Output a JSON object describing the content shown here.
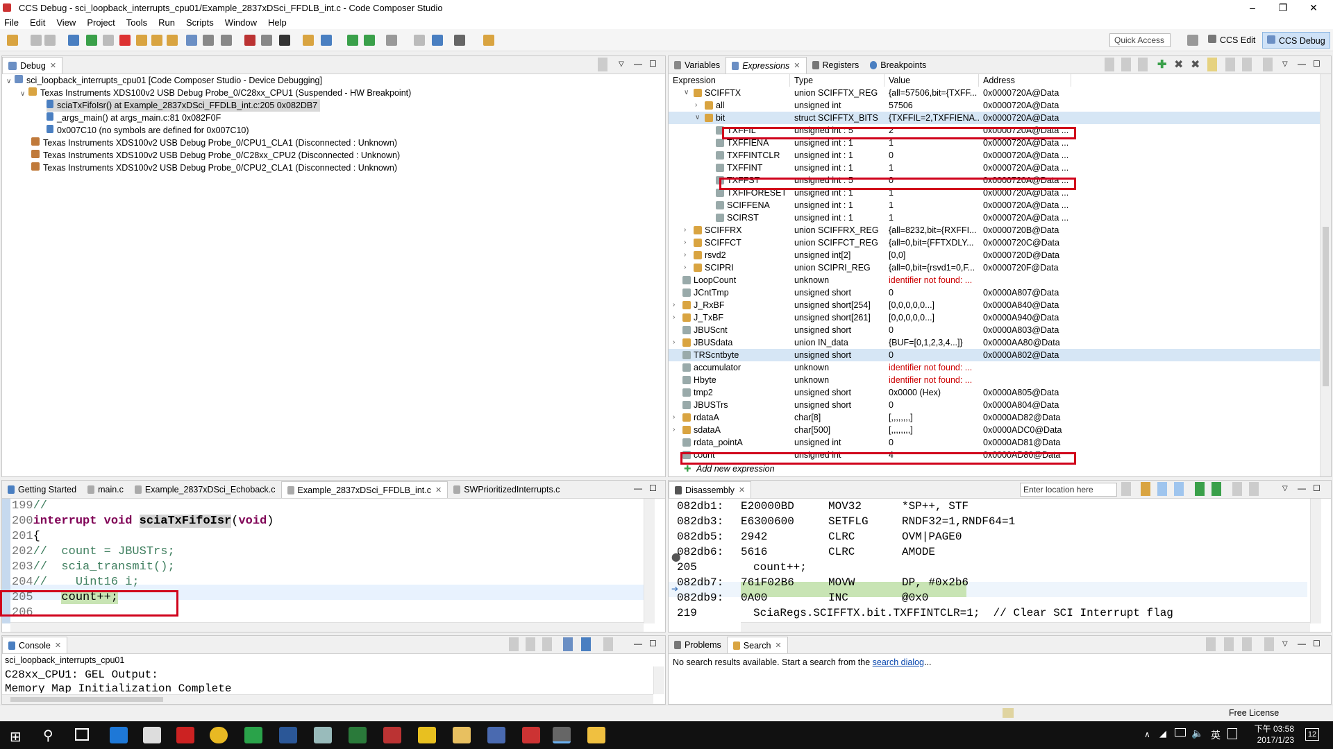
{
  "window": {
    "title": "CCS Debug - sci_loopback_interrupts_cpu01/Example_2837xDSci_FFDLB_int.c - Code Composer Studio",
    "minimize": "–",
    "maximize": "❐",
    "close": "✕"
  },
  "menu": [
    "File",
    "Edit",
    "View",
    "Project",
    "Tools",
    "Run",
    "Scripts",
    "Window",
    "Help"
  ],
  "toolbar": {
    "quick_access": "Quick Access",
    "perspective_edit": "CCS Edit",
    "perspective_debug": "CCS Debug"
  },
  "debug": {
    "tab": "Debug",
    "items": [
      "sci_loopback_interrupts_cpu01 [Code Composer Studio - Device Debugging]",
      "Texas Instruments XDS100v2 USB Debug Probe_0/C28xx_CPU1 (Suspended - HW Breakpoint)",
      "sciaTxFifoIsr() at Example_2837xDSci_FFDLB_int.c:205 0x082DB7",
      "_args_main() at args_main.c:81 0x082F0F",
      "0x007C10  (no symbols are defined for 0x007C10)",
      "Texas Instruments XDS100v2 USB Debug Probe_0/CPU1_CLA1 (Disconnected : Unknown)",
      "Texas Instruments XDS100v2 USB Debug Probe_0/C28xx_CPU2 (Disconnected : Unknown)",
      "Texas Instruments XDS100v2 USB Debug Probe_0/CPU2_CLA1 (Disconnected : Unknown)"
    ]
  },
  "expressions": {
    "tabs": [
      "Variables",
      "Expressions",
      "Registers",
      "Breakpoints"
    ],
    "columns": [
      "Expression",
      "Type",
      "Value",
      "Address"
    ],
    "rows": [
      {
        "name": "SCIFFTX",
        "type": "union SCIFFTX_REG",
        "value": "{all=57506,bit={TXFF...",
        "address": "0x0000720A@Data"
      },
      {
        "name": "all",
        "type": "unsigned int",
        "value": "57506",
        "address": "0x0000720A@Data"
      },
      {
        "name": "bit",
        "type": "struct SCIFFTX_BITS",
        "value": "{TXFFIL=2,TXFFIENA...",
        "address": "0x0000720A@Data"
      },
      {
        "name": "TXFFIL",
        "type": "unsigned int : 5",
        "value": "2",
        "address": "0x0000720A@Data ..."
      },
      {
        "name": "TXFFIENA",
        "type": "unsigned int : 1",
        "value": "1",
        "address": "0x0000720A@Data ..."
      },
      {
        "name": "TXFFINTCLR",
        "type": "unsigned int : 1",
        "value": "0",
        "address": "0x0000720A@Data ..."
      },
      {
        "name": "TXFFINT",
        "type": "unsigned int : 1",
        "value": "1",
        "address": "0x0000720A@Data ..."
      },
      {
        "name": "TXFFST",
        "type": "unsigned int : 5",
        "value": "0",
        "address": "0x0000720A@Data ..."
      },
      {
        "name": "TXFIFORESET",
        "type": "unsigned int : 1",
        "value": "1",
        "address": "0x0000720A@Data ..."
      },
      {
        "name": "SCIFFENA",
        "type": "unsigned int : 1",
        "value": "1",
        "address": "0x0000720A@Data ..."
      },
      {
        "name": "SCIRST",
        "type": "unsigned int : 1",
        "value": "1",
        "address": "0x0000720A@Data ..."
      },
      {
        "name": "SCIFFRX",
        "type": "union SCIFFRX_REG",
        "value": "{all=8232,bit={RXFFI...",
        "address": "0x0000720B@Data"
      },
      {
        "name": "SCIFFCT",
        "type": "union SCIFFCT_REG",
        "value": "{all=0,bit={FFTXDLY...",
        "address": "0x0000720C@Data"
      },
      {
        "name": "rsvd2",
        "type": "unsigned int[2]",
        "value": "[0,0]",
        "address": "0x0000720D@Data"
      },
      {
        "name": "SCIPRI",
        "type": "union SCIPRI_REG",
        "value": "{all=0,bit={rsvd1=0,F...",
        "address": "0x0000720F@Data"
      },
      {
        "name": "LoopCount",
        "type": "unknown",
        "value": "identifier not found: ...",
        "address": ""
      },
      {
        "name": "JCntTmp",
        "type": "unsigned short",
        "value": "0",
        "address": "0x0000A807@Data"
      },
      {
        "name": "J_RxBF",
        "type": "unsigned short[254]",
        "value": "[0,0,0,0,0...]",
        "address": "0x0000A840@Data"
      },
      {
        "name": "J_TxBF",
        "type": "unsigned short[261]",
        "value": "[0,0,0,0,0...]",
        "address": "0x0000A940@Data"
      },
      {
        "name": "JBUScnt",
        "type": "unsigned short",
        "value": "0",
        "address": "0x0000A803@Data"
      },
      {
        "name": "JBUSdata",
        "type": "union IN_data",
        "value": "{BUF=[0,1,2,3,4...]}",
        "address": "0x0000AA80@Data"
      },
      {
        "name": "TRScntbyte",
        "type": "unsigned short",
        "value": "0",
        "address": "0x0000A802@Data"
      },
      {
        "name": "accumulator",
        "type": "unknown",
        "value": "identifier not found: ...",
        "address": ""
      },
      {
        "name": "Hbyte",
        "type": "unknown",
        "value": "identifier not found: ...",
        "address": ""
      },
      {
        "name": "tmp2",
        "type": "unsigned short",
        "value": "0x0000 (Hex)",
        "address": "0x0000A805@Data"
      },
      {
        "name": "JBUSTrs",
        "type": "unsigned short",
        "value": "0",
        "address": "0x0000A804@Data"
      },
      {
        "name": "rdataA",
        "type": "char[8]",
        "value": "[,,,,,,,,]",
        "address": "0x0000AD82@Data"
      },
      {
        "name": "sdataA",
        "type": "char[500]",
        "value": "[,,,,,,,,]",
        "address": "0x0000ADC0@Data"
      },
      {
        "name": "rdata_pointA",
        "type": "unsigned int",
        "value": "0",
        "address": "0x0000AD81@Data"
      },
      {
        "name": "count",
        "type": "unsigned int",
        "value": "4",
        "address": "0x0000AD80@Data"
      }
    ],
    "add_new": "Add new expression"
  },
  "editor": {
    "tabs": [
      "Getting Started",
      "main.c",
      "Example_2837xDSci_Echoback.c",
      "Example_2837xDSci_FFDLB_int.c",
      "SWPrioritizedInterrupts.c"
    ],
    "lines": [
      "199 //",
      "200 interrupt void sciaTxFifoIsr(void)",
      "201 {",
      "202 //  count = JBUSTrs;",
      "203 //  scia_transmit();",
      "204 //    Uint16 i;",
      "205     count++;",
      "206"
    ]
  },
  "disassembly": {
    "tab": "Disassembly",
    "location_placeholder": "Enter location here",
    "lines": [
      {
        "addr": "082db1:",
        "op": "E20000BD",
        "mn": "MOV32",
        "args": "*SP++, STF"
      },
      {
        "addr": "082db3:",
        "op": "E6300600",
        "mn": "SETFLG",
        "args": "RNDF32=1,RNDF64=1"
      },
      {
        "addr": "082db5:",
        "op": "2942",
        "mn": "CLRC",
        "args": "OVM|PAGE0"
      },
      {
        "addr": "082db6:",
        "op": "5616",
        "mn": "CLRC",
        "args": "AMODE"
      },
      {
        "addr": "205",
        "op": "count++;",
        "mn": "",
        "args": ""
      },
      {
        "addr": "082db7:",
        "op": "761F02B6",
        "mn": "MOVW",
        "args": "DP, #0x2b6"
      },
      {
        "addr": "082db9:",
        "op": "0A00",
        "mn": "INC",
        "args": "@0x0"
      },
      {
        "addr": "219",
        "op": "SciaRegs.SCIFFTX.bit.TXFFINTCLR=1;  // Clear SCI Interrupt flag",
        "mn": "",
        "args": ""
      }
    ]
  },
  "console": {
    "tab": "Console",
    "project": "sci_loopback_interrupts_cpu01",
    "lines": [
      "C28xx_CPU1: GEL Output:",
      "Memory Map Initialization Complete"
    ]
  },
  "problems": {
    "tabs": [
      "Problems",
      "Search"
    ],
    "message": "No search results available. Start a search from the ",
    "link": "search dialog",
    "suffix": "..."
  },
  "statusbar": {
    "license": "Free License"
  },
  "taskbar": {
    "time": "下午 03:58",
    "date": "2017/1/23",
    "ime": "英",
    "notif": "12"
  }
}
